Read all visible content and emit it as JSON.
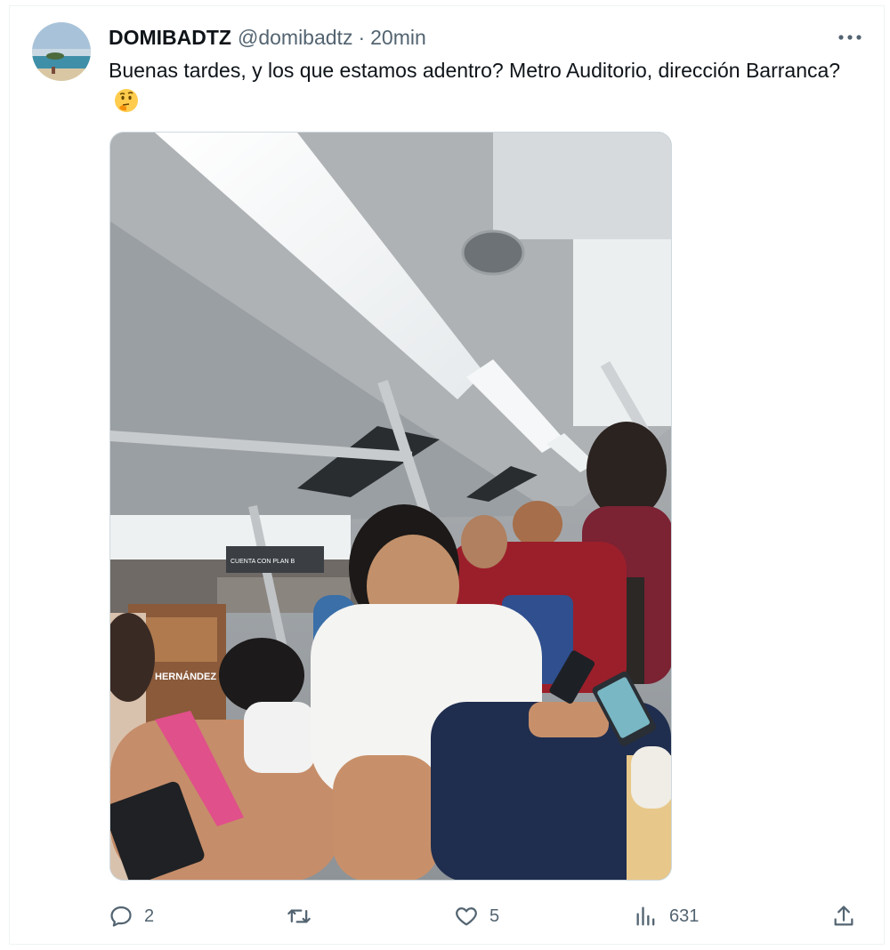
{
  "author": {
    "display_name": "DOMIBADTZ",
    "handle": "@domibadtz",
    "separator": "·",
    "time": "20min"
  },
  "tweet": {
    "text": "Buenas tardes, y los que estamos adentro? Metro Auditorio, dirección Barranca?",
    "emoji": "thinking-face-icon"
  },
  "media": {
    "alt": ""
  },
  "signs": {
    "ad_text": "HERNÁNDEZ",
    "banner": "CUENTA CON PLAN B"
  },
  "actions": {
    "replies": "2",
    "retweets": "",
    "likes": "5",
    "views": "631"
  },
  "icons": {
    "more": "more-dots-icon",
    "reply": "reply-icon",
    "retweet": "retweet-icon",
    "like": "heart-icon",
    "views": "views-chart-icon",
    "share": "share-icon"
  },
  "colors": {
    "text_primary": "#0f1419",
    "text_secondary": "#536471",
    "border": "#cfd9de"
  }
}
